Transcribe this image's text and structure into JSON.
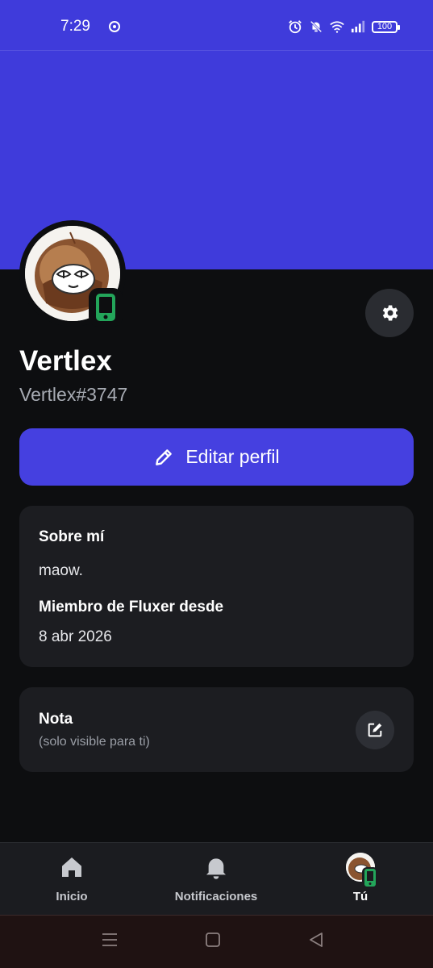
{
  "status_bar": {
    "time": "7:29",
    "battery": "100"
  },
  "profile": {
    "display_name": "Vertlex",
    "username": "Vertlex#3747",
    "banner_color": "#3f3bdb",
    "status": "mobile-online"
  },
  "actions": {
    "edit_label": "Editar perfil"
  },
  "about": {
    "title": "Sobre mí",
    "bio": "maow.",
    "member_since_title": "Miembro de Fluxer desde",
    "member_since": "8 abr 2026"
  },
  "note": {
    "title": "Nota",
    "subtitle": "(solo visible para ti)"
  },
  "bottom_nav": {
    "items": [
      {
        "label": "Inicio",
        "icon": "home-icon"
      },
      {
        "label": "Notificaciones",
        "icon": "bell-icon"
      },
      {
        "label": "Tú",
        "icon": "avatar",
        "active": true
      }
    ]
  },
  "colors": {
    "accent": "#4540e0",
    "online_green": "#23a55a",
    "card_bg": "#1c1d21"
  }
}
